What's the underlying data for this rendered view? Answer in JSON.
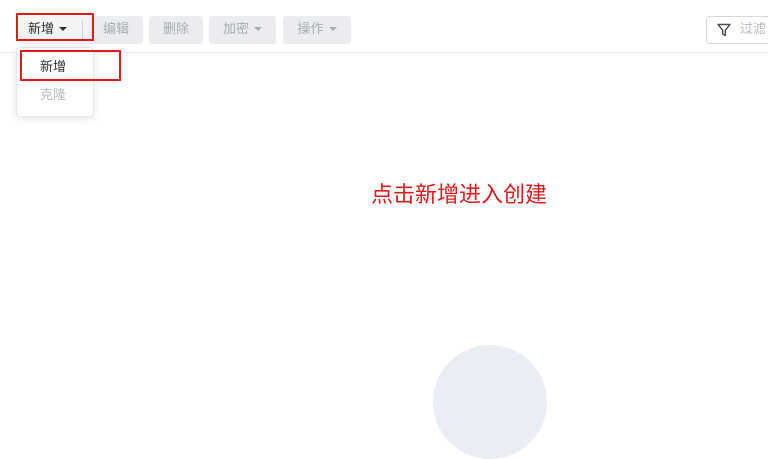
{
  "toolbar": {
    "new_label": "新增",
    "edit_label": "编辑",
    "delete_label": "删除",
    "encrypt_label": "加密",
    "operate_label": "操作",
    "filter_placeholder": "过滤"
  },
  "dropdown": {
    "items": [
      {
        "label": "新增",
        "enabled": true
      },
      {
        "label": "克隆",
        "enabled": false
      }
    ]
  },
  "annotation": {
    "hint": "点击新增进入创建",
    "color": "#e01a1a"
  },
  "icons": {
    "filter": "filter-icon",
    "caret": "caret-down-icon"
  },
  "colors": {
    "highlight": "#e11b1b",
    "disabled_text": "#a8abb2",
    "disabled_bg": "#eaecef",
    "illustration": "#e9edf4"
  }
}
